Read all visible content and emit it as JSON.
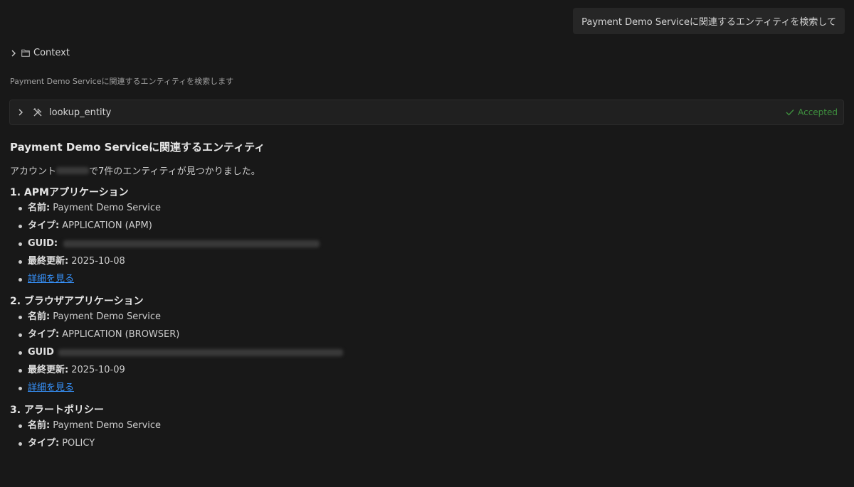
{
  "user_message": "Payment Demo Serviceに関連するエンティティを検索して",
  "context": {
    "label": "Context"
  },
  "status": "Payment Demo Serviceに関連するエンティティを検索します",
  "tool_call": {
    "name": "lookup_entity",
    "state": "Accepted"
  },
  "response": {
    "heading": "Payment Demo Serviceに関連するエンティティ",
    "intro_prefix": "アカウント",
    "intro_suffix": "で7件のエンティティが見つかりました。",
    "sections": [
      {
        "title": "1. APMアプリケーション",
        "items": [
          {
            "key": "名前:",
            "value": "Payment Demo Service"
          },
          {
            "key": "タイプ:",
            "value": "APPLICATION (APM)"
          },
          {
            "key": "GUID:",
            "value": ""
          },
          {
            "key": "最終更新:",
            "value": "2025-10-08"
          }
        ],
        "link": "詳細を見る"
      },
      {
        "title": "2. ブラウザアプリケーション",
        "items": [
          {
            "key": "名前:",
            "value": "Payment Demo Service"
          },
          {
            "key": "タイプ:",
            "value": "APPLICATION (BROWSER)"
          },
          {
            "key": "GUID",
            "value": ""
          },
          {
            "key": "最終更新:",
            "value": "2025-10-09"
          }
        ],
        "link": "詳細を見る"
      },
      {
        "title": "3. アラートポリシー",
        "items": [
          {
            "key": "名前:",
            "value": "Payment Demo Service"
          },
          {
            "key": "タイプ:",
            "value": "POLICY"
          }
        ]
      }
    ]
  },
  "colors": {
    "background": "#181818",
    "link": "#3794ff",
    "accepted": "#3e8f3e"
  }
}
